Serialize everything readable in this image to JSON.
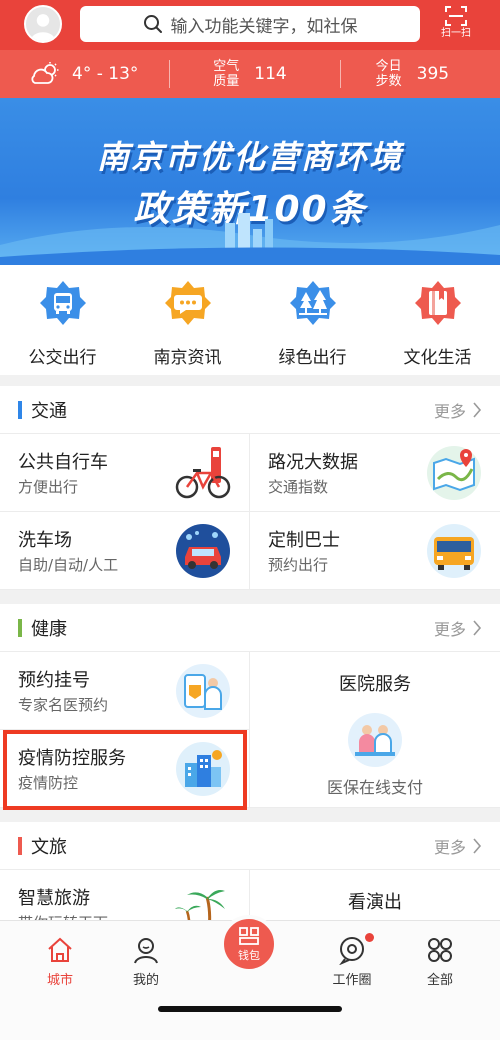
{
  "header": {
    "search_placeholder": "输入功能关键字，如社保",
    "scan_label": "扫一扫"
  },
  "stats": {
    "weather": "4° - 13°",
    "air_label": "空气质量",
    "air_value": "114",
    "steps_label": "今日步数",
    "steps_value": "395"
  },
  "banner": {
    "line1": "南京市优化营商环境",
    "line2": "政策新100条"
  },
  "quicknav": [
    {
      "label": "公交出行",
      "icon": "bus-icon",
      "color": "#3b8fe8"
    },
    {
      "label": "南京资讯",
      "icon": "chat-icon",
      "color": "#f6a623"
    },
    {
      "label": "绿色出行",
      "icon": "trees-icon",
      "color": "#3b8fe8"
    },
    {
      "label": "文化生活",
      "icon": "book-icon",
      "color": "#ee5a4f"
    }
  ],
  "sections": {
    "traffic": {
      "title": "交通",
      "more": "更多",
      "accent": "#2f86e8",
      "cards": [
        {
          "title": "公共自行车",
          "sub": "方便出行",
          "icon": "bicycle-icon"
        },
        {
          "title": "路况大数据",
          "sub": "交通指数",
          "icon": "map-icon"
        },
        {
          "title": "洗车场",
          "sub": "自助/自动/人工",
          "icon": "car-wash-icon"
        },
        {
          "title": "定制巴士",
          "sub": "预约出行",
          "icon": "bus-icon"
        }
      ]
    },
    "health": {
      "title": "健康",
      "more": "更多",
      "accent": "#7ab648",
      "cards": [
        {
          "title": "预约挂号",
          "sub": "专家名医预约",
          "icon": "doctor-icon"
        },
        {
          "title": "医院服务",
          "sub": "医保在线支付",
          "icon": "hospital-icon"
        },
        {
          "title": "疫情防控服务",
          "sub": "疫情防控",
          "icon": "city-icon"
        }
      ]
    },
    "culture": {
      "title": "文旅",
      "more": "更多",
      "accent": "#ee5a4f",
      "cards": [
        {
          "title": "智慧旅游",
          "sub": "带你玩转天下",
          "icon": "palm-tree-icon"
        },
        {
          "title": "看演出",
          "icon": "theater-icon"
        }
      ]
    }
  },
  "tabbar": [
    {
      "label": "城市",
      "icon": "home-icon",
      "active": true
    },
    {
      "label": "我的",
      "icon": "user-icon"
    },
    {
      "label": "钱包",
      "icon": "wallet-icon"
    },
    {
      "label": "工作圈",
      "icon": "chat-circle-icon"
    },
    {
      "label": "全部",
      "icon": "grid-icon"
    }
  ],
  "colors": {
    "brand": "#e9433b",
    "stats_bg": "#ee5a4f",
    "highlight": "#ee3a22"
  }
}
